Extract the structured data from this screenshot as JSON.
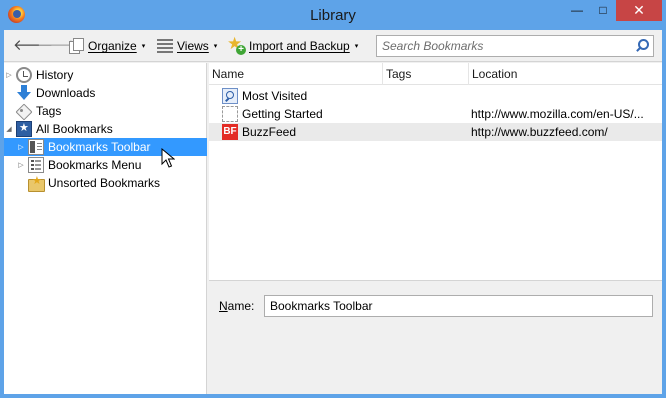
{
  "window": {
    "title": "Library"
  },
  "title_controls": {
    "minimize": "—",
    "maximize": "□",
    "close": "✕"
  },
  "toolbar": {
    "back_icon": "arrow-left-icon",
    "forward_icon": "arrow-right-icon",
    "organize": {
      "label": "Organize",
      "arrow": "▾"
    },
    "views": {
      "label": "Views",
      "arrow": "▾"
    },
    "import_backup": {
      "label": "Import and Backup",
      "arrow": "▾"
    },
    "search": {
      "placeholder": "Search Bookmarks",
      "value": ""
    }
  },
  "sidebar": {
    "items": [
      {
        "label": "History",
        "twisty": "▷",
        "icon": "clock-icon"
      },
      {
        "label": "Downloads",
        "twisty": "",
        "icon": "download-icon"
      },
      {
        "label": "Tags",
        "twisty": "",
        "icon": "tag-icon"
      },
      {
        "label": "All Bookmarks",
        "twisty": "◢",
        "icon": "all-bookmarks-icon"
      },
      {
        "label": "Bookmarks Toolbar",
        "twisty": "▷",
        "icon": "bookmarks-toolbar-icon",
        "selected": true
      },
      {
        "label": "Bookmarks Menu",
        "twisty": "▷",
        "icon": "bookmarks-menu-icon"
      },
      {
        "label": "Unsorted Bookmarks",
        "twisty": "",
        "icon": "unsorted-bookmarks-icon"
      }
    ]
  },
  "list": {
    "columns": [
      "Name",
      "Tags",
      "Location"
    ],
    "rows": [
      {
        "name": "Most Visited",
        "tags": "",
        "location": "",
        "icon": "most-visited-icon"
      },
      {
        "name": "Getting Started",
        "tags": "",
        "location": "http://www.mozilla.com/en-US/...",
        "icon": "page-icon"
      },
      {
        "name": "BuzzFeed",
        "tags": "",
        "location": "http://www.buzzfeed.com/",
        "icon": "buzzfeed-icon",
        "icon_text": "BF"
      }
    ]
  },
  "details": {
    "name_label_accel": "N",
    "name_label_rest": "ame:",
    "name_value": "Bookmarks Toolbar"
  },
  "colors": {
    "titlebar": "#5ea3e8",
    "selection": "#3399ff",
    "close_button": "#c74545",
    "buzzfeed": "#e32b24"
  }
}
